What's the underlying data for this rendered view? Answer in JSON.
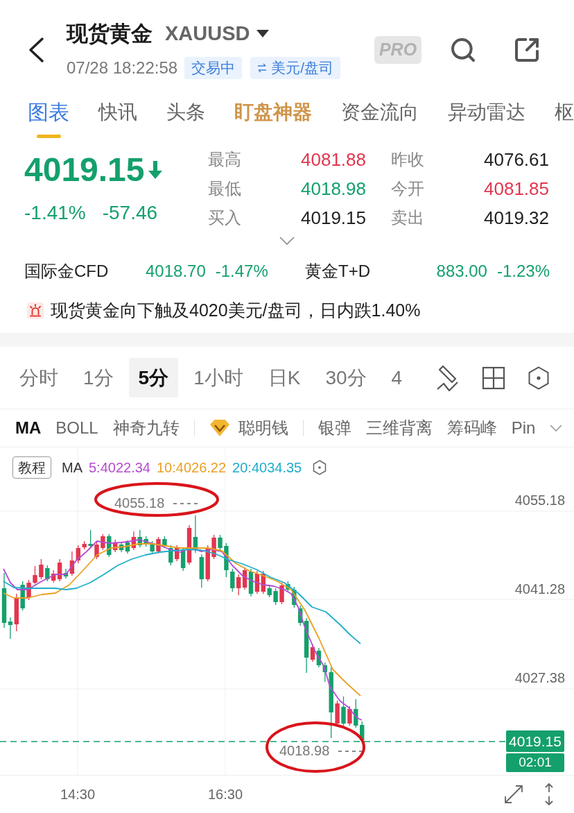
{
  "header": {
    "title": "现货黄金",
    "symbol": "XAUUSD",
    "timestamp": "07/28 18:22:58",
    "badges": [
      {
        "label": "交易中",
        "kind": "status"
      },
      {
        "label": "美元/盘司",
        "kind": "unit"
      }
    ],
    "pro_label": "PRO"
  },
  "tabs": [
    {
      "label": "图表",
      "kind": "plain",
      "selected": true
    },
    {
      "label": "快讯",
      "kind": "plain",
      "selected": false
    },
    {
      "label": "头条",
      "kind": "plain",
      "selected": false
    },
    {
      "label": "盯盘神器",
      "kind": "featured",
      "selected": false
    },
    {
      "label": "资金流向",
      "kind": "plain",
      "selected": false
    },
    {
      "label": "异动雷达",
      "kind": "plain",
      "selected": false
    },
    {
      "label": "枢",
      "kind": "plain",
      "selected": false
    }
  ],
  "quote": {
    "price": "4019.15",
    "falling": true,
    "change_percent": "-1.41%",
    "change": "-57.46",
    "stats": [
      {
        "label": "最高",
        "value": "4081.88",
        "color": "#e2364f"
      },
      {
        "label": "昨收",
        "value": "4076.61",
        "color": "#222222"
      },
      {
        "label": "最低",
        "value": "4018.98",
        "color": "#14a06c"
      },
      {
        "label": "今开",
        "value": "4081.85",
        "color": "#e2364f"
      },
      {
        "label": "买入",
        "value": "4019.15",
        "color": "#222222"
      },
      {
        "label": "卖出",
        "value": "4019.32",
        "color": "#222222"
      }
    ]
  },
  "related": [
    {
      "name": "国际金CFD",
      "price": "4018.70",
      "change": "-1.47%",
      "color": "#14a06c"
    },
    {
      "name": "黄金T+D",
      "price": "883.00",
      "change": "-1.23%",
      "color": "#14a06c"
    }
  ],
  "alert": {
    "text": "现货黄金向下触及4020美元/盘司，日内跌1.40%"
  },
  "intervals": [
    {
      "label": "分时",
      "selected": false
    },
    {
      "label": "1分",
      "selected": false
    },
    {
      "label": "5分",
      "selected": true
    },
    {
      "label": "1小时",
      "selected": false
    },
    {
      "label": "日K",
      "selected": false
    },
    {
      "label": "30分",
      "selected": false
    },
    {
      "label": "4",
      "selected": false
    }
  ],
  "indicators": [
    {
      "label": "MA",
      "kind": "basic",
      "selected": true
    },
    {
      "label": "BOLL",
      "kind": "basic",
      "selected": false
    },
    {
      "label": "神奇九转",
      "kind": "basic",
      "selected": false
    },
    {
      "label": "聪明钱",
      "kind": "premium",
      "selected": false
    },
    {
      "label": "银弹",
      "kind": "basic",
      "selected": false
    },
    {
      "label": "三维背离",
      "kind": "basic",
      "selected": false
    },
    {
      "label": "筹码峰",
      "kind": "basic",
      "selected": false
    },
    {
      "label": "Pin",
      "kind": "basic",
      "selected": false
    }
  ],
  "chart": {
    "tutorial_label": "教程",
    "ma_label": "MA",
    "ma_values": [
      {
        "text": "5:4022.34",
        "color": "#b64bd2"
      },
      {
        "text": "10:4026.22",
        "color": "#e9a023"
      },
      {
        "text": "20:4034.35",
        "color": "#1eaecb"
      }
    ],
    "y_labels": [
      "4055.18",
      "4041.28",
      "4027.38"
    ],
    "high_marker": "4055.18",
    "low_marker": "4018.98",
    "last_price": "4019.15",
    "countdown": "02:01",
    "x_labels": [
      "14:30",
      "16:30"
    ]
  }
}
